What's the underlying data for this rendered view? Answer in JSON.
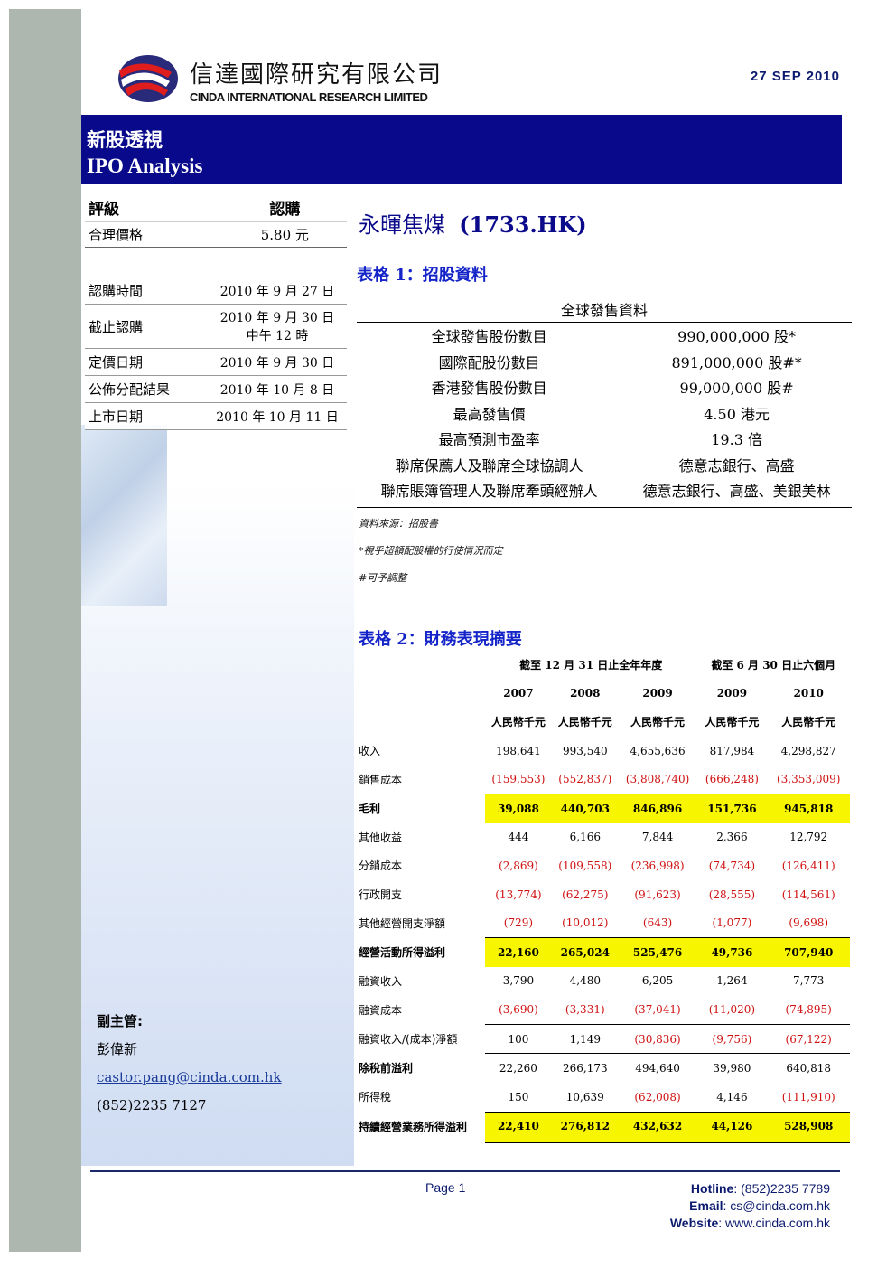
{
  "header": {
    "company_cn": "信達國際研究有限公司",
    "company_en": "CINDA INTERNATIONAL RESEARCH LIMITED",
    "date": "27 SEP 2010"
  },
  "banner": {
    "title_cn": "新股透視",
    "title_en": "IPO Analysis"
  },
  "rating": {
    "label": "評級",
    "value": "認購",
    "fair_price_label": "合理價格",
    "fair_price": "5.80 元"
  },
  "schedule": [
    {
      "label": "認購時間",
      "value": "2010 年 9 月 27 日"
    },
    {
      "label": "截止認購",
      "value": "2010 年 9 月 30 日",
      "value2": "中午 12 時"
    },
    {
      "label": "定價日期",
      "value": "2010 年 9 月 30 日"
    },
    {
      "label": "公佈分配結果",
      "value": "2010 年 10 月 8 日"
    },
    {
      "label": "上市日期",
      "value": "2010 年 10 月 11 日"
    }
  ],
  "contact": {
    "title": "副主管:",
    "name": "彭偉新",
    "email": "castor.pang@cinda.com.hk",
    "phone": "(852)2235 7127"
  },
  "stock": {
    "name_cn": "永暉焦煤",
    "code": "(1733.HK)"
  },
  "table1": {
    "caption": "表格 1：招股資料",
    "header": "全球發售資料",
    "rows": [
      {
        "k": "全球發售股份數目",
        "v": "990,000,000 股*"
      },
      {
        "k": "國際配股份數目",
        "v": "891,000,000 股#*"
      },
      {
        "k": "香港發售股份數目",
        "v": "99,000,000 股#"
      },
      {
        "k": "最高發售價",
        "v": "4.50 港元"
      },
      {
        "k": "最高預測市盈率",
        "v": "19.3 倍"
      },
      {
        "k": "聯席保薦人及聯席全球協調人",
        "v": "德意志銀行、高盛"
      },
      {
        "k": "聯席賬簿管理人及聯席牽頭經辦人",
        "v": "德意志銀行、高盛、美銀美林"
      }
    ],
    "notes": [
      "資料來源：招股書",
      "*視乎超額配股權的行使情況而定",
      "#可予調整"
    ]
  },
  "table2": {
    "caption": "表格 2：財務表現摘要",
    "period_full": "截至 12 月 31 日止全年年度",
    "period_half": "截至 6 月 30 日止六個月",
    "years": [
      "2007",
      "2008",
      "2009",
      "2009",
      "2010"
    ],
    "unit": "人民幣千元",
    "rows": {
      "revenue": {
        "label": "收入",
        "v": [
          "198,641",
          "993,540",
          "4,655,636",
          "817,984",
          "4,298,827"
        ]
      },
      "cost": {
        "label": "銷售成本",
        "v": [
          "(159,553)",
          "(552,837)",
          "(3,808,740)",
          "(666,248)",
          "(3,353,009)"
        ]
      },
      "gross": {
        "label": "毛利",
        "v": [
          "39,088",
          "440,703",
          "846,896",
          "151,736",
          "945,818"
        ]
      },
      "other_income": {
        "label": "其他收益",
        "v": [
          "444",
          "6,166",
          "7,844",
          "2,366",
          "12,792"
        ]
      },
      "distribution": {
        "label": "分銷成本",
        "v": [
          "(2,869)",
          "(109,558)",
          "(236,998)",
          "(74,734)",
          "(126,411)"
        ]
      },
      "admin": {
        "label": "行政開支",
        "v": [
          "(13,774)",
          "(62,275)",
          "(91,623)",
          "(28,555)",
          "(114,561)"
        ]
      },
      "other_op": {
        "label": "其他經營開支淨額",
        "v": [
          "(729)",
          "(10,012)",
          "(643)",
          "(1,077)",
          "(9,698)"
        ]
      },
      "op_profit": {
        "label": "經營活動所得溢利",
        "v": [
          "22,160",
          "265,024",
          "525,476",
          "49,736",
          "707,940"
        ]
      },
      "fin_income": {
        "label": "融資收入",
        "v": [
          "3,790",
          "4,480",
          "6,205",
          "1,264",
          "7,773"
        ]
      },
      "fin_cost": {
        "label": "融資成本",
        "v": [
          "(3,690)",
          "(3,331)",
          "(37,041)",
          "(11,020)",
          "(74,895)"
        ]
      },
      "fin_net": {
        "label": "融資收入/(成本)淨額",
        "v": [
          "100",
          "1,149",
          "(30,836)",
          "(9,756)",
          "(67,122)"
        ]
      },
      "pbt": {
        "label": "除稅前溢利",
        "v": [
          "22,260",
          "266,173",
          "494,640",
          "39,980",
          "640,818"
        ]
      },
      "tax": {
        "label": "所得稅",
        "v": [
          "150",
          "10,639",
          "(62,008)",
          "4,146",
          "(111,910)"
        ]
      },
      "net": {
        "label": "持續經營業務所得溢利",
        "v": [
          "22,410",
          "276,812",
          "432,632",
          "44,126",
          "528,908"
        ]
      }
    }
  },
  "footer": {
    "page": "Page 1",
    "hotline_label": "Hotline",
    "hotline": ": (852)2235 7789",
    "email_label": "Email",
    "email": ": cs@cinda.com.hk",
    "website_label": "Website",
    "website": ": www.cinda.com.hk"
  },
  "colors": {
    "banner": "#08098b",
    "caption": "#1424c8",
    "highlight": "#f7f500",
    "negative": "#d01010"
  }
}
